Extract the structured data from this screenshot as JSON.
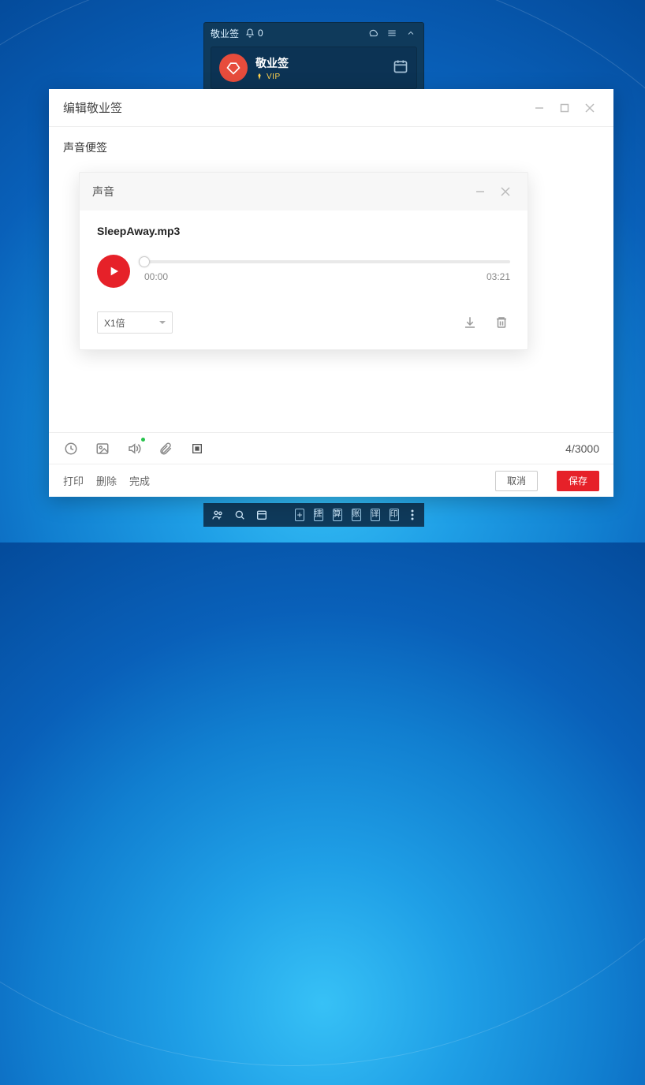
{
  "backApp": {
    "title": "敬业签",
    "notif_count": "0",
    "header_name": "敬业签",
    "vip_text": "VIP",
    "footer_tiles": [
      "捷",
      "算",
      "账",
      "译",
      "印"
    ]
  },
  "modal": {
    "title": "编辑敬业签",
    "note_label": "声音便签",
    "counter": "4/3000",
    "links": {
      "print": "打印",
      "delete": "删除",
      "done": "完成"
    },
    "buttons": {
      "cancel": "取消",
      "save": "保存"
    }
  },
  "sound": {
    "title": "声音",
    "filename": "SleepAway.mp3",
    "currentTime": "00:00",
    "duration": "03:21",
    "speed": "X1倍"
  }
}
